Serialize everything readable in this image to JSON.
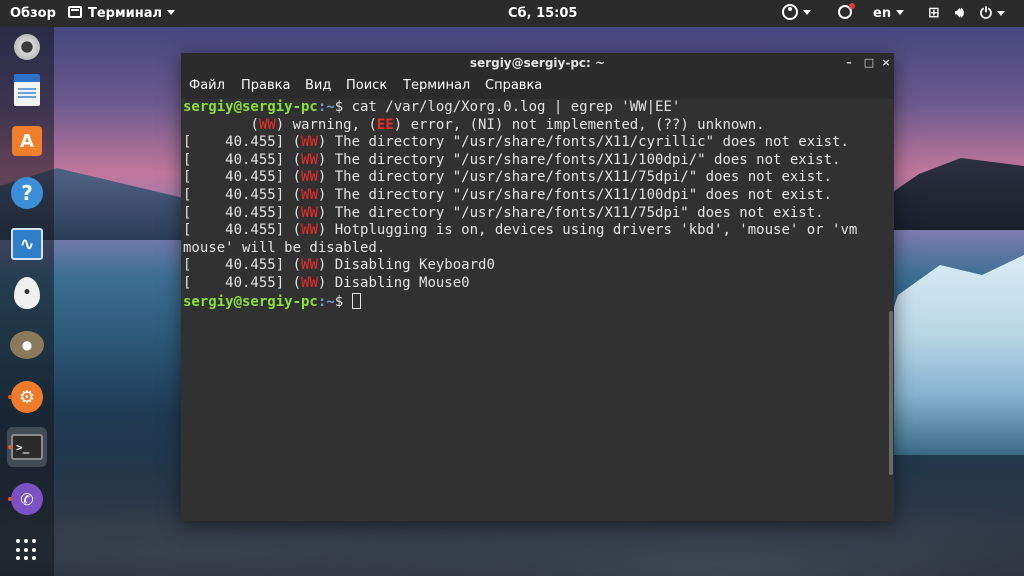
{
  "top_panel": {
    "activities": "Обзор",
    "app_menu": "Терминал",
    "clock": "Сб, 15:05",
    "language": "en"
  },
  "dock": {
    "items": [
      {
        "name": "webcam",
        "glyph": ""
      },
      {
        "name": "document-viewer",
        "glyph": ""
      },
      {
        "name": "software-store",
        "glyph": "A"
      },
      {
        "name": "help",
        "glyph": "?"
      },
      {
        "name": "system-monitor",
        "glyph": "∿"
      },
      {
        "name": "egg-app",
        "glyph": "•"
      },
      {
        "name": "gimp",
        "glyph": "●"
      },
      {
        "name": "settings-tools",
        "glyph": "⚙"
      },
      {
        "name": "terminal",
        "glyph": ">_"
      },
      {
        "name": "viber",
        "glyph": "✆"
      }
    ]
  },
  "window": {
    "title": "sergiy@sergiy-pc: ~",
    "controls": {
      "minimize": "–",
      "maximize": "□",
      "close": "×"
    },
    "menu": [
      "Файл",
      "Правка",
      "Вид",
      "Поиск",
      "Терминал",
      "Справка"
    ]
  },
  "terminal": {
    "prompt_user": "sergiy@sergiy-pc",
    "prompt_path": ":~",
    "prompt_symbol": "$ ",
    "command": "cat /var/log/Xorg.0.log | egrep 'WW|EE'",
    "legend": {
      "indent": "\t",
      "open1": "(",
      "ww": "WW",
      "after_ww": ") warning, (",
      "ee": "EE",
      "after_ee": ") error, (NI) not implemented, (??) unknown."
    },
    "log_lines": [
      {
        "ts": "[    40.455] (",
        "tag": "WW",
        "msg": ") The directory \"/usr/share/fonts/X11/cyrillic\" does not exist."
      },
      {
        "ts": "[    40.455] (",
        "tag": "WW",
        "msg": ") The directory \"/usr/share/fonts/X11/100dpi/\" does not exist."
      },
      {
        "ts": "[    40.455] (",
        "tag": "WW",
        "msg": ") The directory \"/usr/share/fonts/X11/75dpi/\" does not exist."
      },
      {
        "ts": "[    40.455] (",
        "tag": "WW",
        "msg": ") The directory \"/usr/share/fonts/X11/100dpi\" does not exist."
      },
      {
        "ts": "[    40.455] (",
        "tag": "WW",
        "msg": ") The directory \"/usr/share/fonts/X11/75dpi\" does not exist."
      },
      {
        "ts": "[    40.455] (",
        "tag": "WW",
        "msg": ") Hotplugging is on, devices using drivers 'kbd', 'mouse' or 'vm"
      },
      {
        "ts": "",
        "tag": "",
        "msg": "mouse' will be disabled."
      },
      {
        "ts": "[    40.455] (",
        "tag": "WW",
        "msg": ") Disabling Keyboard0"
      },
      {
        "ts": "[    40.455] (",
        "tag": "WW",
        "msg": ") Disabling Mouse0"
      }
    ]
  }
}
